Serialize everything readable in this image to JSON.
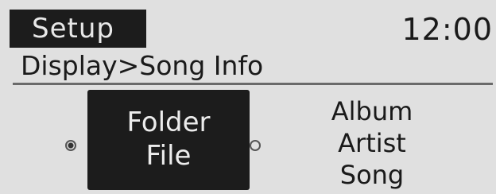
{
  "header": {
    "title": "Setup",
    "clock": "12:00"
  },
  "breadcrumb": {
    "text": "Display>Song Info"
  },
  "options": [
    {
      "lines": [
        "Folder",
        "File"
      ],
      "selected": true
    },
    {
      "lines": [
        "Album",
        "Artist",
        "Song"
      ],
      "selected": false
    }
  ],
  "colors": {
    "background": "#e0e0e0",
    "highlight": "#1c1c1c",
    "text": "#1a1a1a"
  }
}
